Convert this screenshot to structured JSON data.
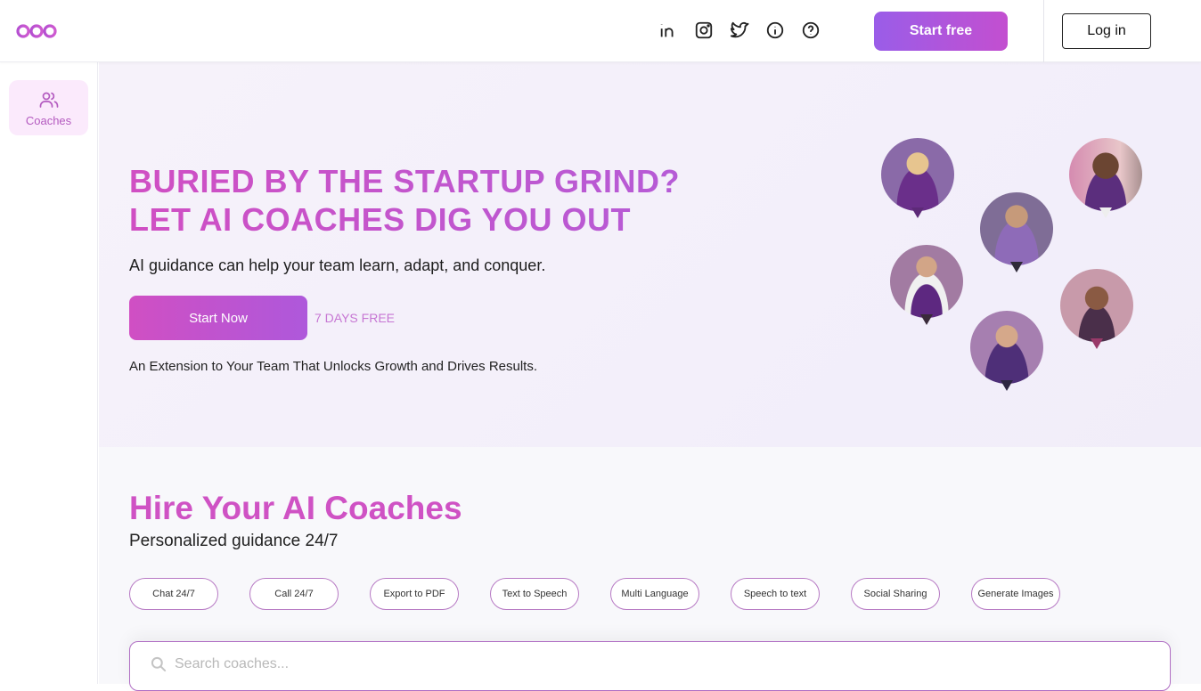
{
  "header": {
    "logo": "ooo-logo",
    "social_icons": [
      "linkedin-icon",
      "instagram-icon",
      "twitter-icon",
      "info-icon",
      "help-icon"
    ],
    "start_free_label": "Start free",
    "login_label": "Log in"
  },
  "sidebar": {
    "items": [
      {
        "label": "Coaches",
        "icon": "users-icon",
        "active": true
      }
    ]
  },
  "hero": {
    "title_line1": "BURIED BY THE STARTUP GRIND?",
    "title_line2": "LET AI COACHES DIG YOU OUT",
    "subtitle": "AI guidance can help your team learn, adapt, and conquer.",
    "cta_label": "Start Now",
    "trial_text": "7 DAYS FREE",
    "tagline": "An Extension to Your Team That Unlocks Growth and Drives Results.",
    "avatars": [
      {
        "desc": "woman-blonde-purple-dress"
      },
      {
        "desc": "man-smiling-purple-suit"
      },
      {
        "desc": "man-curly-hair-lavender-suit"
      },
      {
        "desc": "woman-brown-hair-purple-vest"
      },
      {
        "desc": "woman-dark-hair-bun"
      },
      {
        "desc": "man-purple-suit-tie"
      }
    ]
  },
  "coaches_section": {
    "title": "Hire Your AI Coaches",
    "subtitle": "Personalized guidance 24/7",
    "features": [
      "Chat 24/7",
      "Call 24/7",
      "Export to PDF",
      "Text to Speech",
      "Multi Language",
      "Speech to text",
      "Social Sharing",
      "Generate Images"
    ],
    "search_placeholder": "Search coaches..."
  },
  "colors": {
    "brand_pink": "#cf52c4",
    "brand_purple": "#9a5de8",
    "sidebar_active_bg": "#fbeafc"
  }
}
